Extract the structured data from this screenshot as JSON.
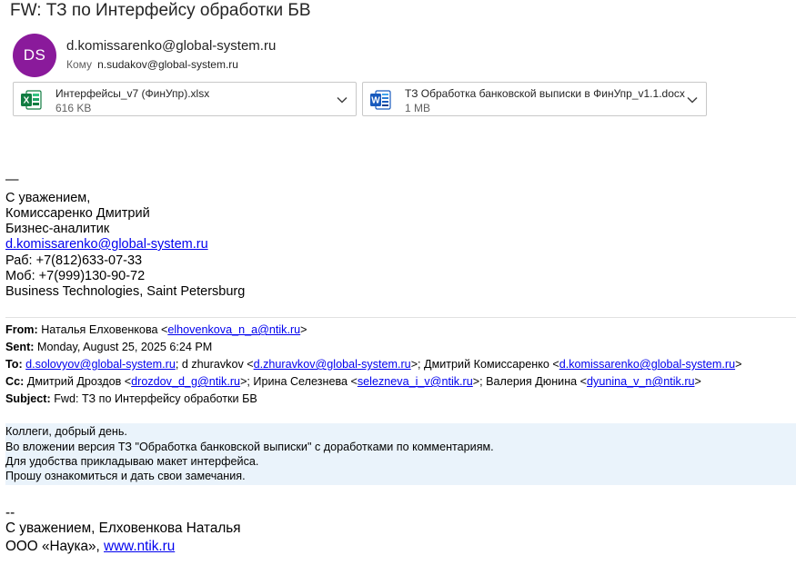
{
  "subject": "FW: ТЗ по Интерфейсу обработки БВ",
  "sender": {
    "initials": "DS",
    "email": "d.komissarenko@global-system.ru",
    "to_label": "Кому",
    "to_address": "n.sudakov@global-system.ru",
    "avatar_color": "#8a1a9b"
  },
  "attachments": [
    {
      "name": "Интерфейсы_v7 (ФинУпр).xlsx",
      "size": "616 KB",
      "icon": "excel-file-icon"
    },
    {
      "name": "ТЗ Обработка банковской выписки в ФинУпр_v1.1.docx",
      "size": "1 MB",
      "icon": "word-file-icon"
    }
  ],
  "signature": {
    "dash": "—",
    "regards": "С уважением,",
    "name": "Комиссаренко Дмитрий",
    "title": "Бизнес-аналитик",
    "email": "d.komissarenko@global-system.ru",
    "work_phone": "Раб: +7(812)633-07-33",
    "mobile_phone": "Моб: +7(999)130-90-72",
    "company": "Business Technologies, Saint Petersburg"
  },
  "forward_header": {
    "from_label": "From:",
    "from_name": "Наталья Елховенкова <",
    "from_email": "elhovenkova_n_a@ntik.ru",
    "from_end": ">",
    "sent_label": "Sent:",
    "sent_value": "Monday, August 25, 2025 6:24 PM",
    "to_label": "To:",
    "to_email1": "d.solovyov@global-system.ru",
    "to_sep1": "; d zhuravkov <",
    "to_email2": "d.zhuravkov@global-system.ru",
    "to_sep2": ">; Дмитрий Комиссаренко <",
    "to_email3": "d.komissarenko@global-system.ru",
    "to_end": ">",
    "cc_label": "Cc:",
    "cc_name1": "Дмитрий Дроздов <",
    "cc_email1": "drozdov_d_g@ntik.ru",
    "cc_sep1": ">; Ирина Селезнева <",
    "cc_email2": "selezneva_i_v@ntik.ru",
    "cc_sep2": ">; Валерия Дюнина <",
    "cc_email3": "dyunina_v_n@ntik.ru",
    "cc_end": ">",
    "subject_label": "Subject:",
    "subject_value": "Fwd: ТЗ по Интерфейсу обработки БВ"
  },
  "body_lines": [
    "Коллеги, добрый день.",
    "Во вложении версия ТЗ \"Обработка банковской выписки\" с доработками по комментариям.",
    "Для удобства прикладываю макет интерфейса.",
    "Прошу ознакомиться и дать свои замечания."
  ],
  "signature2": {
    "dash": "--",
    "regards": "С уважением, Елховенкова Наталья",
    "org": "ООО «Наука», ",
    "link": "www.ntik.ru"
  }
}
